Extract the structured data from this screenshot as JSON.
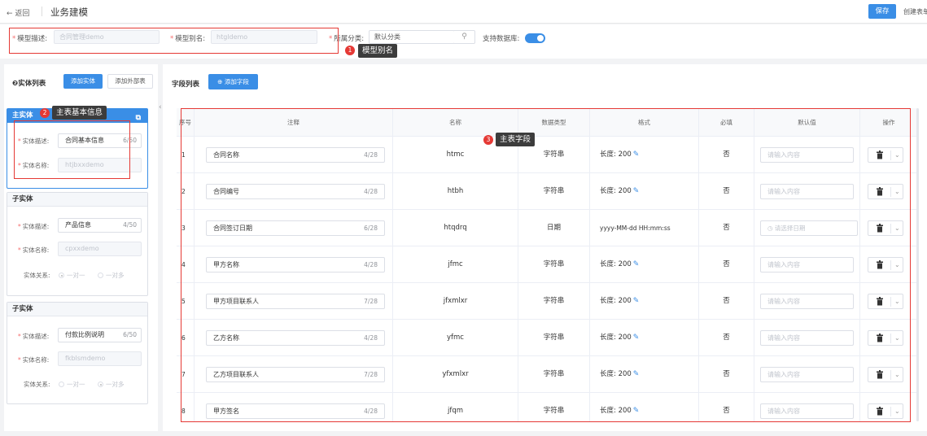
{
  "topbar": {
    "back": "← 返回",
    "title": "业务建模",
    "save": "保存",
    "create": "创建表单"
  },
  "form": {
    "desc_label": "模型描述:",
    "desc_value": "合同管理demo",
    "alias_label": "模型别名:",
    "alias_value": "htgldemo",
    "category_label": "所属分类:",
    "category_value": "默认分类",
    "support_label": "支持数据库:"
  },
  "annotations": [
    {
      "num": "1",
      "label": "模型别名"
    },
    {
      "num": "2",
      "label": "主表基本信息"
    },
    {
      "num": "3",
      "label": "主表字段"
    }
  ],
  "left": {
    "title": "❷实体列表",
    "add_entity": "添加实体",
    "add_external": "添加外部表",
    "desc_label": "实体描述:",
    "name_label": "实体名称:",
    "rel_label": "实体关系:",
    "main": {
      "head": "主实体",
      "desc": "合同基本信息",
      "count": "6/50",
      "name": "htjbxxdemo"
    },
    "subs": [
      {
        "head": "子实体",
        "desc": "产品信息",
        "count": "4/50",
        "name": "cpxxdemo",
        "rel": [
          "一对一",
          "一对多"
        ],
        "selected": 0
      },
      {
        "head": "子实体",
        "desc": "付款比例说明",
        "count": "6/50",
        "name": "fkblsmdemo",
        "rel": [
          "一对一",
          "一对多"
        ],
        "selected": 1
      }
    ]
  },
  "right": {
    "title": "字段列表",
    "add_field": "⊕ 添加字段",
    "headers": [
      "序号",
      "注释",
      "名称",
      "数据类型",
      "格式",
      "必填",
      "默认值",
      "操作"
    ],
    "placeholder": "请输入内容",
    "date_placeholder": "◷ 请选择日期",
    "rows": [
      {
        "no": "1",
        "comment": "合同名称",
        "count": "4/28",
        "name": "htmc",
        "type": "字符串",
        "format": "长度: 200",
        "required": "否",
        "date": false
      },
      {
        "no": "2",
        "comment": "合同编号",
        "count": "4/28",
        "name": "htbh",
        "type": "字符串",
        "format": "长度: 200",
        "required": "否",
        "date": false
      },
      {
        "no": "3",
        "comment": "合同签订日期",
        "count": "6/28",
        "name": "htqdrq",
        "type": "日期",
        "format": "yyyy-MM-dd HH:mm:ss",
        "required": "否",
        "date": true
      },
      {
        "no": "4",
        "comment": "甲方名称",
        "count": "4/28",
        "name": "jfmc",
        "type": "字符串",
        "format": "长度: 200",
        "required": "否",
        "date": false
      },
      {
        "no": "5",
        "comment": "甲方项目联系人",
        "count": "7/28",
        "name": "jfxmlxr",
        "type": "字符串",
        "format": "长度: 200",
        "required": "否",
        "date": false
      },
      {
        "no": "6",
        "comment": "乙方名称",
        "count": "4/28",
        "name": "yfmc",
        "type": "字符串",
        "format": "长度: 200",
        "required": "否",
        "date": false
      },
      {
        "no": "7",
        "comment": "乙方项目联系人",
        "count": "7/28",
        "name": "yfxmlxr",
        "type": "字符串",
        "format": "长度: 200",
        "required": "否",
        "date": false
      },
      {
        "no": "8",
        "comment": "甲方签名",
        "count": "4/28",
        "name": "jfqm",
        "type": "字符串",
        "format": "长度: 200",
        "required": "否",
        "date": false
      }
    ]
  },
  "colors": {
    "primary": "#3a8ee6",
    "annotation_red": "#e53935",
    "tooltip": "#3c3c3c"
  }
}
